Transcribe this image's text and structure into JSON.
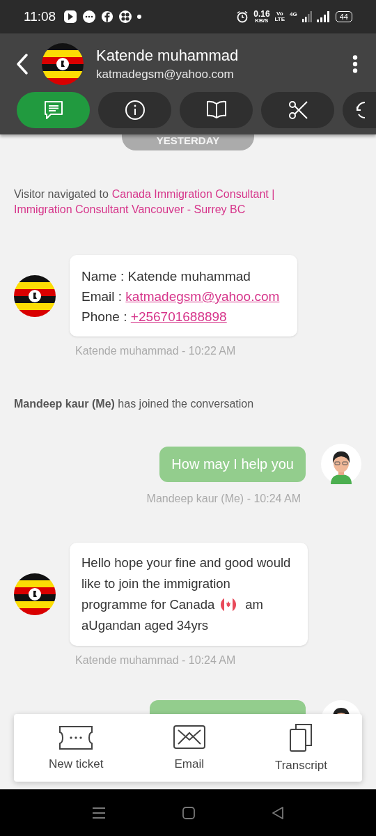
{
  "status_bar": {
    "time": "11:08",
    "speed": "0.16",
    "speed_unit": "KB/S",
    "volte_top": "Vo",
    "volte_bottom": "LTE",
    "network": "4G",
    "battery": "44"
  },
  "header": {
    "name": "Katende muhammad",
    "email": "katmadegsm@yahoo.com"
  },
  "tabs": [
    {
      "selected": true
    },
    {
      "selected": false
    },
    {
      "selected": false
    },
    {
      "selected": false
    },
    {
      "selected": false
    }
  ],
  "day_label": "YESTERDAY",
  "messages": [
    {
      "kind": "navigation",
      "text": "Visitor navigated to ",
      "link": "Canada Immigration Consultant |",
      "link_2": "Immigration Consultant Vancouver - Surrey BC"
    },
    {
      "kind": "visitor_card",
      "fields": [
        {
          "label": "Name : ",
          "value": "Katende muhammad",
          "link": false
        },
        {
          "label": "Email : ",
          "value": "katmadegsm@yahoo.com",
          "link": true
        },
        {
          "label": "Phone : ",
          "value": "+256701688898",
          "link": true
        }
      ],
      "meta": "Katende muhammad - 10:22 AM"
    },
    {
      "kind": "notice",
      "text": "**Mandeep kaur (Me)** has joined the conversation"
    },
    {
      "kind": "agent",
      "text": "How may  I help you",
      "meta": "Mandeep kaur (Me) - 10:24 AM"
    },
    {
      "kind": "visitor",
      "text": "Hello hope your fine and good would like to join the immigration",
      "text_mid": "programme for Canada",
      "text_after": "am",
      "text_end": "aUgandan aged 34yrs",
      "meta": "Katende muhammad - 10:24 AM"
    },
    {
      "kind": "agent_partial"
    }
  ],
  "actions": [
    {
      "label": "New ticket"
    },
    {
      "label": "Email"
    },
    {
      "label": "Transcript"
    }
  ]
}
